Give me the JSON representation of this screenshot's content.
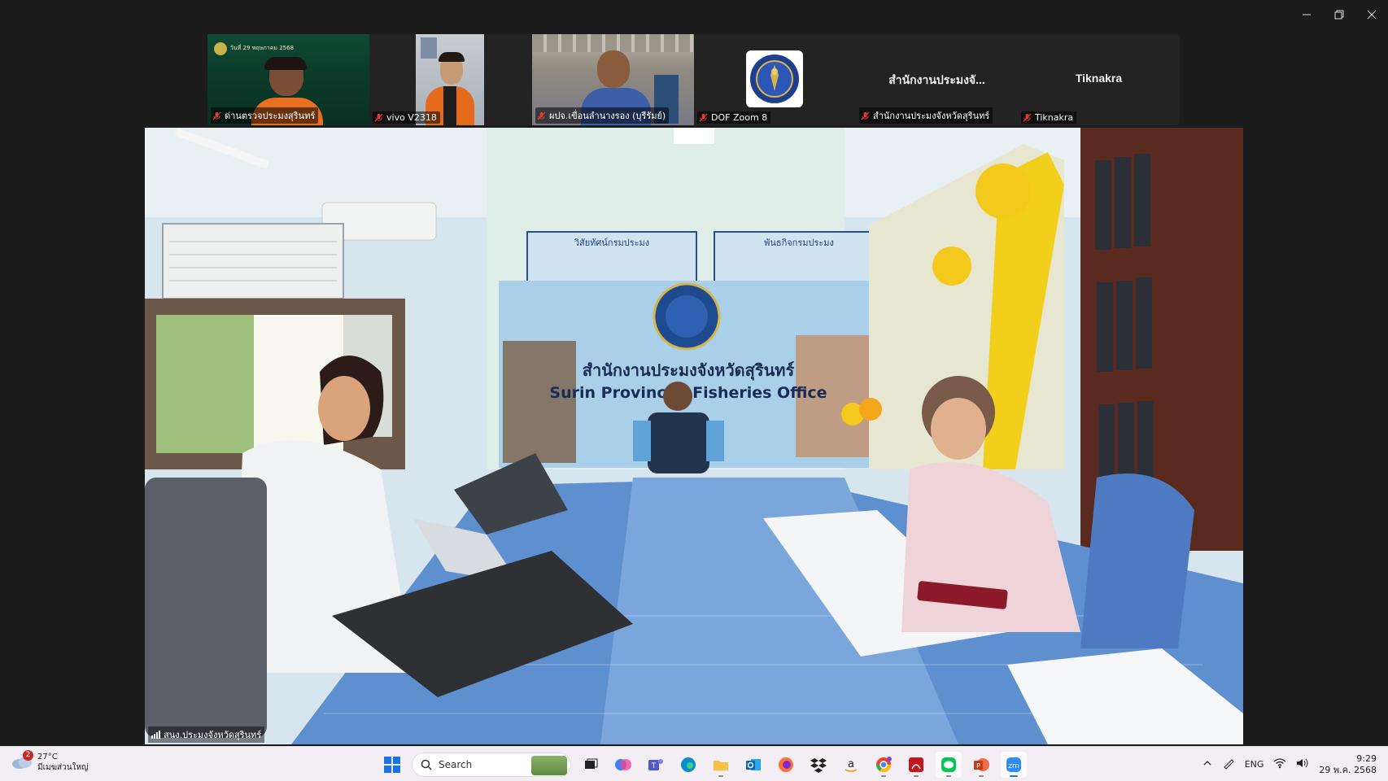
{
  "window": {
    "minimize_icon": "minimize-icon",
    "restore_icon": "restore-icon",
    "close_icon": "close-icon"
  },
  "participants": [
    {
      "name": "ด่านตรวจประมงสุรินทร์",
      "banner": "วันที่ 29 พฤษภาคม 2568",
      "muted": true,
      "kind": "video"
    },
    {
      "name": "vivo V2318",
      "muted": true,
      "kind": "video"
    },
    {
      "name": "ผปจ.เขื่อนลำนางรอง (บุรีรัมย์)",
      "muted": true,
      "kind": "video"
    },
    {
      "name": "DOF Zoom 8",
      "muted": true,
      "kind": "logo"
    },
    {
      "name": "สำนักงานประมงจังหวัดสุรินทร์",
      "display": "สำนักงานประมงจั...",
      "muted": true,
      "kind": "name"
    },
    {
      "name": "Tiknakra",
      "display": "Tiknakra",
      "muted": true,
      "kind": "name"
    }
  ],
  "main_speaker": {
    "name": "สนง.ประมงจังหวัดสุรินทร์",
    "backdrop_th": "สำนักงานประมงจังหวัดสุรินทร์",
    "backdrop_en": "Surin Provincial Fisheries Office",
    "board_left": "วิสัยทัศน์กรมประมง",
    "board_right": "พันธกิจกรมประมง"
  },
  "taskbar": {
    "weather_temp": "27°C",
    "weather_desc": "มีเมฆส่วนใหญ่",
    "weather_badge": "2",
    "search_placeholder": "Search",
    "lang": "ENG",
    "time": "9:29",
    "date": "29 พ.ค. 2568",
    "apps": [
      "windows-start-icon",
      "task-view-icon",
      "copilot-icon",
      "teams-icon",
      "edge-icon",
      "file-explorer-icon",
      "outlook-icon",
      "firefox-icon",
      "dropbox-icon",
      "amazon-icon",
      "chrome-icon",
      "acrobat-icon",
      "line-icon",
      "powerpoint-icon",
      "zoom-icon"
    ]
  }
}
